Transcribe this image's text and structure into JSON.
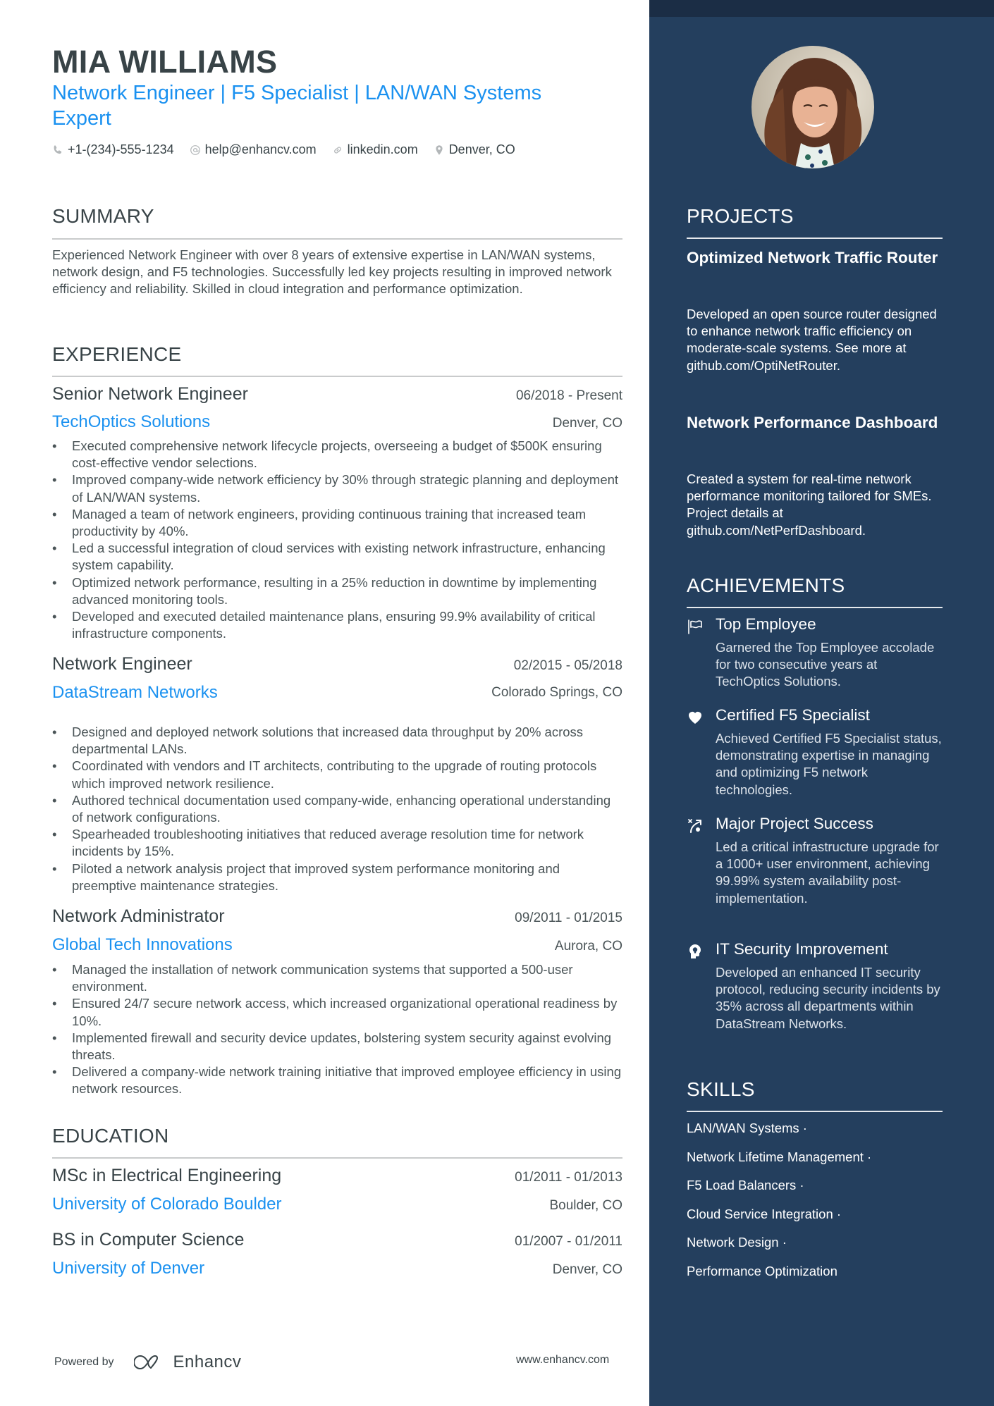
{
  "header": {
    "name": "MIA WILLIAMS",
    "headline": "Network Engineer | F5 Specialist | LAN/WAN Systems Expert",
    "contacts": [
      {
        "icon": "phone-icon",
        "text": "+1-(234)-555-1234"
      },
      {
        "icon": "at-icon",
        "text": "help@enhancv.com"
      },
      {
        "icon": "link-icon",
        "text": "linkedin.com"
      },
      {
        "icon": "location-pin-icon",
        "text": "Denver, CO"
      }
    ]
  },
  "summary": {
    "title": "SUMMARY",
    "text": "Experienced Network Engineer with over 8 years of extensive expertise in LAN/WAN systems, network design, and F5 technologies. Successfully led key projects resulting in improved network efficiency and reliability. Skilled in cloud integration and performance optimization."
  },
  "experience": {
    "title": "EXPERIENCE",
    "jobs": [
      {
        "role": "Senior Network Engineer",
        "dates": "06/2018 - Present",
        "company": "TechOptics Solutions",
        "location": "Denver, CO",
        "bullets": [
          "Executed comprehensive network lifecycle projects, overseeing a budget of $500K ensuring cost-effective vendor selections.",
          "Improved company-wide network efficiency by 30% through strategic planning and deployment of LAN/WAN systems.",
          "Managed a team of network engineers, providing continuous training that increased team productivity by 40%.",
          "Led a successful integration of cloud services with existing network infrastructure, enhancing system capability.",
          "Optimized network performance, resulting in a 25% reduction in downtime by implementing advanced monitoring tools.",
          "Developed and executed detailed maintenance plans, ensuring 99.9% availability of critical infrastructure components."
        ]
      },
      {
        "role": "Network Engineer",
        "dates": "02/2015 - 05/2018",
        "company": "DataStream Networks",
        "location": "Colorado Springs, CO",
        "bullets": [
          "Designed and deployed network solutions that increased data throughput by 20% across departmental LANs.",
          "Coordinated with vendors and IT architects, contributing to the upgrade of routing protocols which improved network resilience.",
          "Authored technical documentation used company-wide, enhancing operational understanding of network configurations.",
          "Spearheaded troubleshooting initiatives that reduced average resolution time for network incidents by 15%.",
          "Piloted a network analysis project that improved system performance monitoring and preemptive maintenance strategies."
        ]
      },
      {
        "role": "Network Administrator",
        "dates": "09/2011 - 01/2015",
        "company": "Global Tech Innovations",
        "location": "Aurora, CO",
        "bullets": [
          "Managed the installation of network communication systems that supported a 500-user environment.",
          "Ensured 24/7 secure network access, which increased organizational operational readiness by 10%.",
          "Implemented firewall and security device updates, bolstering system security against evolving threats.",
          "Delivered a company-wide network training initiative that improved employee efficiency in using network resources."
        ]
      }
    ]
  },
  "education": {
    "title": "EDUCATION",
    "items": [
      {
        "degree": "MSc in Electrical Engineering",
        "dates": "01/2011 - 01/2013",
        "school": "University of Colorado Boulder",
        "location": "Boulder, CO"
      },
      {
        "degree": "BS in Computer Science",
        "dates": "01/2007 - 01/2011",
        "school": "University of Denver",
        "location": "Denver, CO"
      }
    ]
  },
  "footer": {
    "powered_by": "Powered by",
    "brand": "Enhancv",
    "website": "www.enhancv.com"
  },
  "sidebar": {
    "photo_alt": "Profile photo of Mia Williams",
    "projects": {
      "title": "PROJECTS",
      "items": [
        {
          "title": "Optimized Network Traffic Router",
          "description": "Developed an open source router designed to enhance network traffic efficiency on moderate-scale systems. See more at github.com/OptiNetRouter."
        },
        {
          "title": "Network Performance Dashboard",
          "description": "Created a system for real-time network performance monitoring tailored for SMEs. Project details at github.com/NetPerfDashboard."
        }
      ]
    },
    "achievements": {
      "title": "ACHIEVEMENTS",
      "items": [
        {
          "icon": "flag-icon",
          "title": "Top Employee",
          "description": "Garnered the Top Employee accolade for two consecutive years at TechOptics Solutions."
        },
        {
          "icon": "heart-icon",
          "title": "Certified F5 Specialist",
          "description": "Achieved Certified F5 Specialist status, demonstrating expertise in managing and optimizing F5 network technologies."
        },
        {
          "icon": "strategy-icon",
          "title": "Major Project Success",
          "description": "Led a critical infrastructure upgrade for a 1000+ user environment, achieving 99.99% system availability post-implementation."
        },
        {
          "icon": "head-bulb-icon",
          "title": "IT Security Improvement",
          "description": "Developed an enhanced IT security protocol, reducing security incidents by 35% across all departments within DataStream Networks."
        }
      ]
    },
    "skills": {
      "title": "SKILLS",
      "items": [
        "LAN/WAN Systems ·",
        "Network Lifetime Management ·",
        "F5 Load Balancers ·",
        "Cloud Service Integration ·",
        "Network Design ·",
        "Performance Optimization"
      ]
    }
  },
  "colors": {
    "accent": "#1a91f0",
    "text": "#384347",
    "sidebar_bg": "#243f5e",
    "sidebar_band": "#1b2d45",
    "rule": "#c9cbcc"
  }
}
